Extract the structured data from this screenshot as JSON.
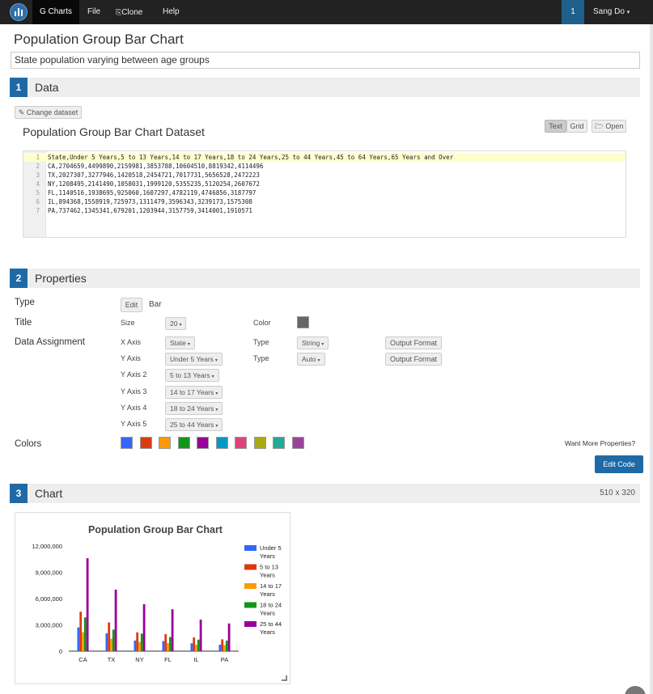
{
  "navbar": {
    "brand": "G Charts",
    "menu": [
      "File",
      "Clone",
      "Help"
    ],
    "badge": "1",
    "user": "Sang Do"
  },
  "page": {
    "title": "Population Group Bar Chart",
    "subtitle": "State population varying between age groups"
  },
  "sections": {
    "data": {
      "num": "1",
      "title": "Data"
    },
    "properties": {
      "num": "2",
      "title": "Properties"
    },
    "chart": {
      "num": "3",
      "title": "Chart",
      "size": "510 x 320"
    }
  },
  "data_section": {
    "change_dataset": "Change dataset",
    "dataset_title": "Population Group Bar Chart Dataset",
    "view_buttons": {
      "text": "Text",
      "grid": "Grid",
      "open": "Open"
    },
    "lines": [
      {
        "n": "1",
        "text": "State,Under 5 Years,5 to 13 Years,14 to 17 Years,18 to 24 Years,25 to 44 Years,45 to 64 Years,65 Years and Over"
      },
      {
        "n": "2",
        "text": "CA,2704659,4499890,2159981,3853788,10604510,8819342,4114496"
      },
      {
        "n": "3",
        "text": "TX,2027307,3277946,1420518,2454721,7017731,5656528,2472223"
      },
      {
        "n": "4",
        "text": "NY,1208495,2141490,1058031,1999120,5355235,5120254,2607672"
      },
      {
        "n": "5",
        "text": "FL,1140516,1938695,925060,1607297,4782119,4746856,3187797"
      },
      {
        "n": "6",
        "text": "IL,894368,1558919,725973,1311479,3596343,3239173,1575308"
      },
      {
        "n": "7",
        "text": "PA,737462,1345341,679201,1203944,3157759,3414001,1910571"
      }
    ]
  },
  "properties": {
    "type_label": "Type",
    "type_edit": "Edit",
    "type_value": "Bar",
    "title_label": "Title",
    "size_label": "Size",
    "size_value": "20",
    "color_label": "Color",
    "title_color": "#666666",
    "data_assignment_label": "Data Assignment",
    "x_axis": {
      "label": "X Axis",
      "value": "State",
      "type_label": "Type",
      "type_value": "String",
      "format": "Output Format"
    },
    "y_axis": {
      "label": "Y Axis",
      "value": "Under 5 Years",
      "type_label": "Type",
      "type_value": "Auto",
      "format": "Output Format"
    },
    "y_axis_2": {
      "label": "Y Axis 2",
      "value": "5 to 13 Years"
    },
    "y_axis_3": {
      "label": "Y Axis 3",
      "value": "14 to 17 Years"
    },
    "y_axis_4": {
      "label": "Y Axis 4",
      "value": "18 to 24 Years"
    },
    "y_axis_5": {
      "label": "Y Axis 5",
      "value": "25 to 44 Years"
    },
    "colors_label": "Colors",
    "colors": [
      "#3366ff",
      "#dc3912",
      "#ff9900",
      "#109618",
      "#990099",
      "#0099c6",
      "#dd4477",
      "#aaaa11",
      "#22aa99",
      "#994499"
    ],
    "want_more": "Want More Properties?",
    "edit_code": "Edit Code"
  },
  "chart_data": {
    "type": "bar",
    "title": "Population Group Bar Chart",
    "categories": [
      "CA",
      "TX",
      "NY",
      "FL",
      "IL",
      "PA"
    ],
    "series": [
      {
        "name": "Under 5 Years",
        "color": "#3366ff",
        "values": [
          2704659,
          2027307,
          1208495,
          1140516,
          894368,
          737462
        ]
      },
      {
        "name": "5 to 13 Years",
        "color": "#dc3912",
        "values": [
          4499890,
          3277946,
          2141490,
          1938695,
          1558919,
          1345341
        ]
      },
      {
        "name": "14 to 17 Years",
        "color": "#ff9900",
        "values": [
          2159981,
          1420518,
          1058031,
          925060,
          725973,
          679201
        ]
      },
      {
        "name": "18 to 24 Years",
        "color": "#109618",
        "values": [
          3853788,
          2454721,
          1999120,
          1607297,
          1311479,
          1203944
        ]
      },
      {
        "name": "25 to 44 Years",
        "color": "#990099",
        "values": [
          10604510,
          7017731,
          5355235,
          4782119,
          3596343,
          3157759
        ]
      }
    ],
    "legend_lines": [
      [
        "Under 5",
        "Years"
      ],
      [
        "5 to 13",
        "Years"
      ],
      [
        "14 to 17",
        "Years"
      ],
      [
        "18 to 24",
        "Years"
      ],
      [
        "25 to 44",
        "Years"
      ]
    ],
    "y_ticks": [
      0,
      3000000,
      6000000,
      9000000,
      12000000
    ],
    "y_tick_labels": [
      "0",
      "3,000,000",
      "6,000,000",
      "9,000,000",
      "12,000,000"
    ],
    "ylim": [
      0,
      12000000
    ],
    "legend": "right",
    "grid": false
  }
}
